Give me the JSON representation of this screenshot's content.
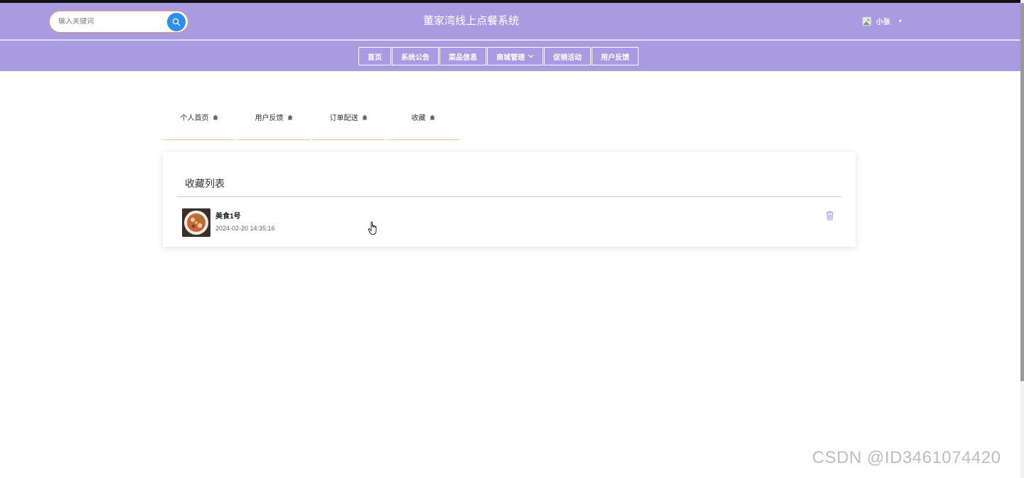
{
  "header": {
    "search_placeholder": "输入关键词",
    "site_title": "董家湾线上点餐系统",
    "username": "小张"
  },
  "nav": {
    "items": [
      {
        "label": "首页"
      },
      {
        "label": "系统公告"
      },
      {
        "label": "菜品信息"
      },
      {
        "label": "商城管理"
      },
      {
        "label": "促销活动"
      },
      {
        "label": "用户反馈"
      }
    ]
  },
  "tabs": [
    {
      "label": "个人首页"
    },
    {
      "label": "用户反馈"
    },
    {
      "label": "订单配送"
    },
    {
      "label": "收藏"
    }
  ],
  "favorites": {
    "title": "收藏列表",
    "items": [
      {
        "name": "美食1号",
        "time": "2024-02-20 14:35:16"
      }
    ]
  },
  "colors": {
    "header_bg": "#a89be1",
    "search_button": "#2f8cf0",
    "tab_underline": "#f0c98a",
    "delete_icon": "#a89be1"
  },
  "icons": {
    "search": "search-icon",
    "delete": "trash-icon",
    "tab": "home-icon",
    "dropdown": "chevron-down-icon"
  },
  "watermark": "CSDN @ID3461074420"
}
